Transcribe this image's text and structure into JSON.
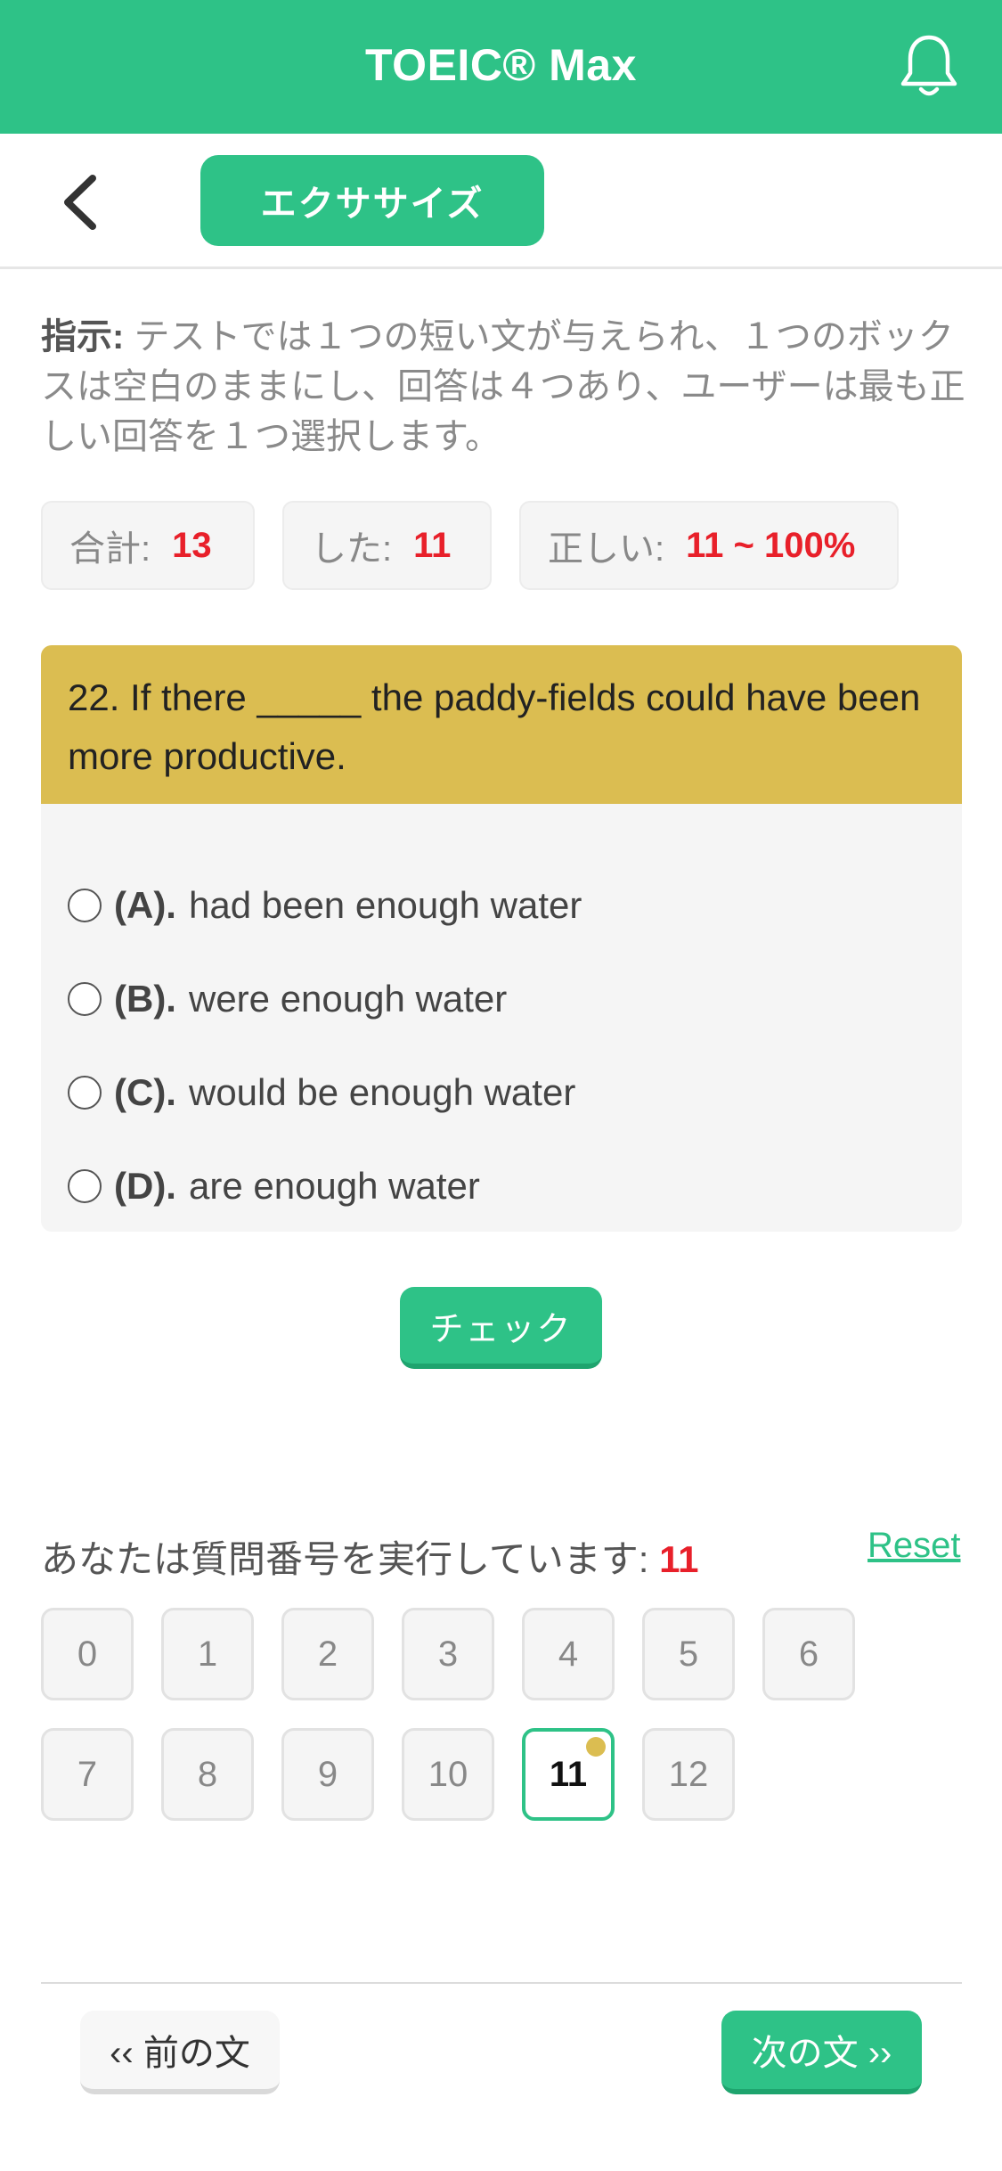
{
  "app": {
    "title": "TOEIC® Max"
  },
  "header": {
    "tab_label": "エクササイズ"
  },
  "instructions": {
    "label": "指示:",
    "text": " テストでは１つの短い文が与えられ、１つのボックスは空白のままにし、回答は４つあり、ユーザーは最も正しい回答を１つ選択します。"
  },
  "stats": {
    "total_label": "合計:",
    "total_value": "13",
    "done_label": "した:",
    "done_value": "11",
    "correct_label": "正しい:",
    "correct_value": "11 ~ 100%"
  },
  "question": {
    "text": "22. If there _____ the paddy-fields could have been more productive.",
    "options": [
      {
        "letter": "(A).",
        "text": "had been enough water"
      },
      {
        "letter": "(B).",
        "text": "were enough water"
      },
      {
        "letter": "(C).",
        "text": "would be enough water"
      },
      {
        "letter": "(D).",
        "text": "are enough water"
      }
    ]
  },
  "check_label": "チェック",
  "progress": {
    "label": "あなたは質問番号を実行しています:",
    "current": "11",
    "reset_label": "Reset",
    "numbers": [
      "0",
      "1",
      "2",
      "3",
      "4",
      "5",
      "6",
      "7",
      "8",
      "9",
      "10",
      "11",
      "12"
    ]
  },
  "nav": {
    "prev_label": "‹‹ 前の文",
    "next_label": "次の文 ››"
  },
  "colors": {
    "accent": "#2ec287",
    "question_bg": "#dbbd51",
    "highlight": "#e8202a"
  }
}
